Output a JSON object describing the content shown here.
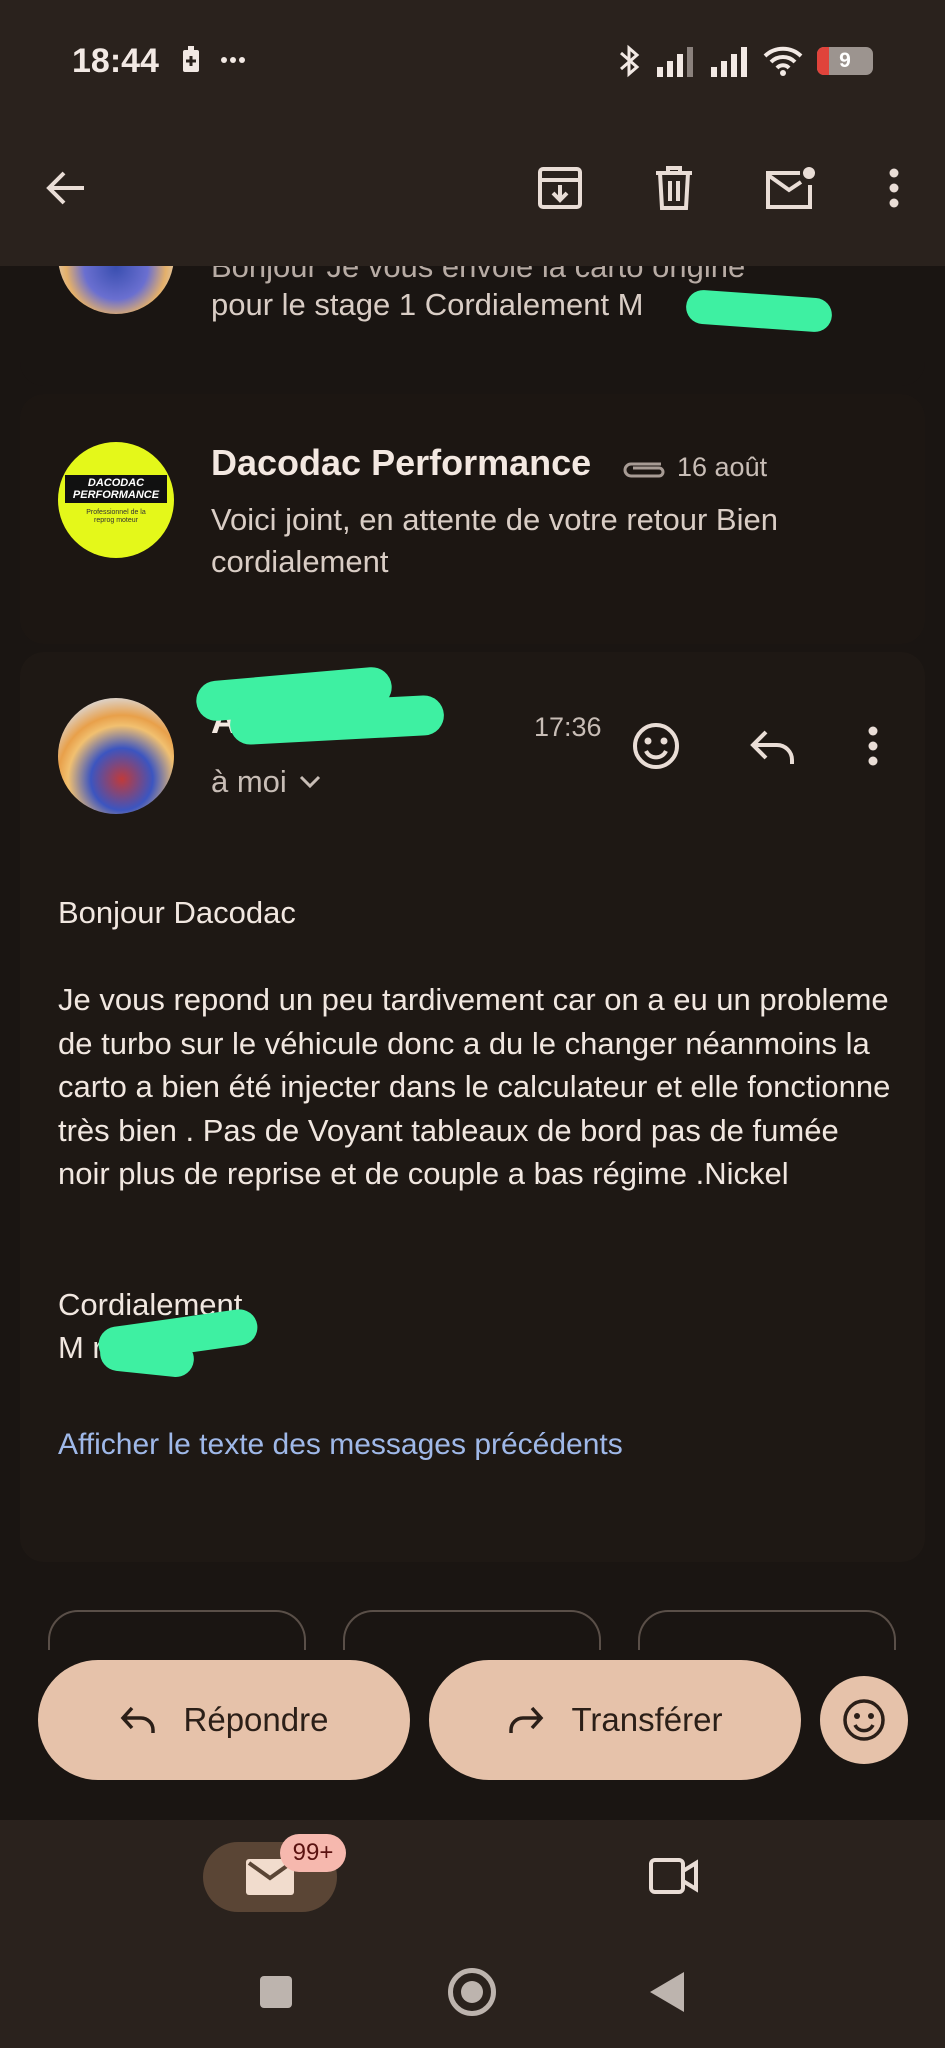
{
  "status_bar": {
    "time": "18:44",
    "battery_level": "9"
  },
  "toolbar": {
    "back_icon": "arrow-left-icon",
    "archive_icon": "archive-icon",
    "delete_icon": "trash-icon",
    "mark_unread_icon": "mail-unread-icon",
    "more_icon": "more-vert-icon"
  },
  "thread": [
    {
      "snippet_top": "Bonjour Je vous envoie la carto origine",
      "snippet": "pour le stage 1 Cordialement M"
    },
    {
      "sender": "Dacodac Performance",
      "date": "16 août",
      "avatar_text_line1": "DACODAC",
      "avatar_text_line2": "PERFORMANCE",
      "avatar_subtext": "Professionnel de la reprog moteur",
      "snippet": "Voici joint, en attente de votre retour Bien cordialement"
    },
    {
      "sender": "Al          fe...",
      "time": "17:36",
      "recipient": "à moi",
      "greeting": "Bonjour Dacodac",
      "paragraph": "Je vous repond un peu tardivement car on a eu un probleme de turbo sur le véhicule donc a du le changer néanmoins la carto a bien été injecter dans le calculateur et elle fonctionne très bien . Pas de Voyant tableaux de bord pas de fumée noir plus de reprise et de couple a bas régime .Nickel",
      "signoff": "Cordialement",
      "signature": "M         re",
      "show_quoted": "Afficher le texte des messages précédents"
    }
  ],
  "actions": {
    "reply": "Répondre",
    "forward": "Transférer"
  },
  "bottom_nav": {
    "mail_badge": "99+"
  },
  "colors": {
    "accent": "#e6c2aa",
    "link": "#9fb8e8",
    "card": "#1e1814",
    "bar": "#2a221d"
  }
}
